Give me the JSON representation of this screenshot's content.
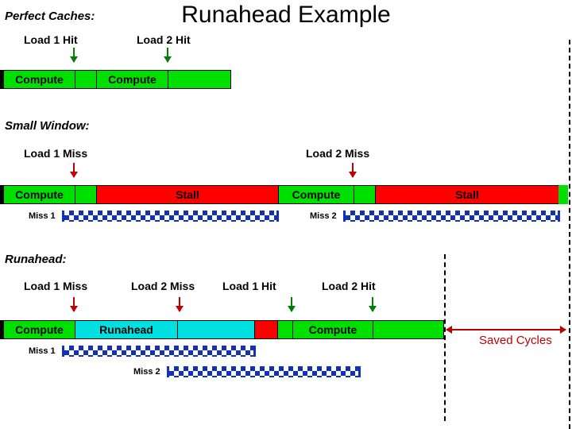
{
  "title": "Runahead Example",
  "sections": {
    "perfect": {
      "label": "Perfect Caches:",
      "loads": [
        "Load 1 Hit",
        "Load 2 Hit"
      ],
      "bars": [
        "Compute",
        "Compute"
      ]
    },
    "small": {
      "label": "Small Window:",
      "loads": [
        "Load 1 Miss",
        "Load 2 Miss"
      ],
      "bars": [
        "Compute",
        "Stall",
        "Compute",
        "Stall"
      ],
      "miss": [
        "Miss 1",
        "Miss 2"
      ]
    },
    "runahead": {
      "label": "Runahead:",
      "loads": [
        "Load 1 Miss",
        "Load 2 Miss",
        "Load 1 Hit",
        "Load 2 Hit"
      ],
      "bars": [
        "Compute",
        "Runahead",
        "Compute"
      ],
      "miss": [
        "Miss 1",
        "Miss 2"
      ]
    }
  },
  "saved_label": "Saved Cycles"
}
